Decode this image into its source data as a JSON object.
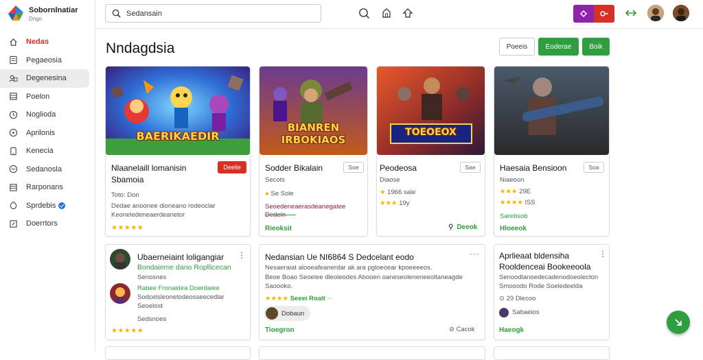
{
  "brand": {
    "name": "Sobornlnatiar",
    "sub": "Dngo"
  },
  "sidebar": {
    "items": [
      {
        "label": "Nedas",
        "icon": "home-icon"
      },
      {
        "label": "Pegaeosia",
        "icon": "document-icon"
      },
      {
        "label": "Degenesina",
        "icon": "people-icon"
      },
      {
        "label": "Poelon",
        "icon": "list-icon"
      },
      {
        "label": "Noglioda",
        "icon": "clock-icon"
      },
      {
        "label": "Aprilonis",
        "icon": "target-icon"
      },
      {
        "label": "Kenecia",
        "icon": "phone-icon"
      },
      {
        "label": "Sedanosla",
        "icon": "settings-icon"
      },
      {
        "label": "Rarponans",
        "icon": "table-icon"
      },
      {
        "label": "Sprdebis",
        "icon": "shield-icon"
      },
      {
        "label": "Doerrtors",
        "icon": "edit-icon"
      }
    ]
  },
  "search": {
    "value": "Sedansain"
  },
  "colors": {
    "accent_red": "#d93025",
    "accent_green": "#2e9e3e",
    "purple": "#8e24aa"
  },
  "page_title": "Nndagdsia",
  "buttons": {
    "outline": "Poeeis",
    "green1": "Eoderae",
    "green2": "Boik"
  },
  "top_cards": [
    {
      "thumb_text": "BAERIKAEDIR",
      "title1": "Nlaanelaill lomanisin",
      "title2": "Sbamoia",
      "tag": "Deelie",
      "meta": "Toto: Don",
      "desc1": "Dedae anoonee dioneano rodeoclar",
      "desc2": "Keoneledeneaerdeanetor",
      "stars": "★★★★★"
    },
    {
      "thumb_text": "BIANREN",
      "thumb_text2": "IRBOKIAOS",
      "title1": "Sodder Bikalain",
      "tag": "Soe",
      "meta": "Secots",
      "meta2": "Se Sole",
      "desc": "Seoedeneaerasdeanegatee Dedeln",
      "link": "Rieoksit",
      "rating": "★★★★★"
    },
    {
      "thumb_text": "TOEOEOX",
      "title1": "Peodeosa",
      "tag": "Sae",
      "meta": "Diaose",
      "meta2": "1966 sale",
      "meta3": "19y",
      "link_icon": "Deeok"
    },
    {
      "thumb_text": "",
      "title1": "Haesaia Bensioon",
      "tag": "Soa",
      "meta": "Niaeoon",
      "meta2": "29E",
      "meta3": "lSS",
      "desc": "Sarebsob",
      "link": "Hloeeok"
    }
  ],
  "bottom_cards": [
    {
      "title": "Ubaerneiaint loligangiar",
      "subtitle": "Bondaieme dano Ropllicecan",
      "meta": "Senosnes",
      "line1": "Rabee Fronaidea Doerdaiee",
      "line2": "Sodcelsleonetodeosseecedlar",
      "line3": "Seoelost",
      "foot": "Sedsnoes",
      "stars": "★★★★★"
    },
    {
      "title": "Nedansian Ue NI6864 S Dedcelant eodo",
      "desc1": "Nesaeraiat alooeafeanerdar ak ara pgloeoear kpoeeeeos.",
      "desc2": "Beoe Boao Seoelee dleoleodes Abooen oaneseoleneneeoltaneagde",
      "desc3": "Saoooko.",
      "badge": "Seeei Roalt",
      "user": "Dobaun",
      "foot": "Tioegron",
      "foot2": "Cacok"
    },
    {
      "title": "Aprlieaat bldensiha",
      "title2": "Rooldenceai Bookeeoola",
      "desc1": "Senoodlanoedecadenodoeolecton",
      "desc2": "Smooodo Rode Soeledeelda",
      "meta": "29 Dlecoo",
      "user": "Sabaeios",
      "foot": "Haeogk"
    }
  ]
}
